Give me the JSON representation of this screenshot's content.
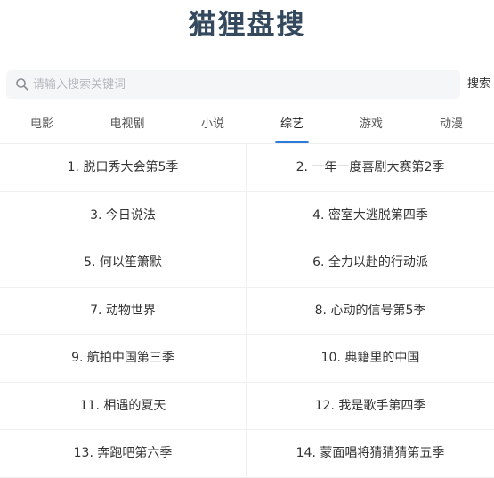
{
  "header": {
    "title": "猫狸盘搜"
  },
  "search": {
    "placeholder": "请输入搜索关键词",
    "value": "",
    "button_label": "搜索"
  },
  "tabs": [
    {
      "label": "电影",
      "active": false
    },
    {
      "label": "电视剧",
      "active": false
    },
    {
      "label": "小说",
      "active": false
    },
    {
      "label": "综艺",
      "active": true
    },
    {
      "label": "游戏",
      "active": false
    },
    {
      "label": "动漫",
      "active": false
    }
  ],
  "items": [
    "1. 脱口秀大会第5季",
    "2. 一年一度喜剧大赛第2季",
    "3. 今日说法",
    "4. 密室大逃脱第四季",
    "5. 何以笙箫默",
    "6. 全力以赴的行动派",
    "7. 动物世界",
    "8. 心动的信号第5季",
    "9. 航拍中国第三季",
    "10. 典籍里的中国",
    "11. 相遇的夏天",
    "12. 我是歌手第四季",
    "13. 奔跑吧第六季",
    "14. 蒙面唱将猜猜猜第五季"
  ],
  "colors": {
    "title": "#34495e",
    "accent": "#2d7bd6"
  }
}
